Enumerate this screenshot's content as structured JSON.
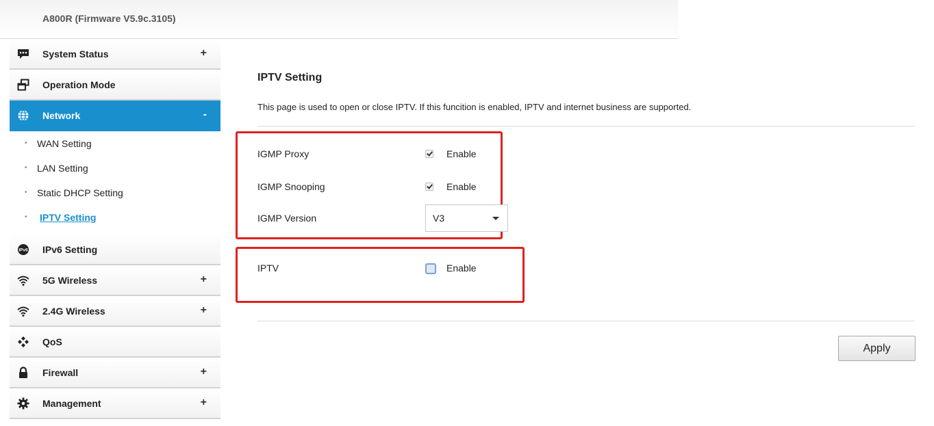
{
  "header": {
    "firmware_title": "A800R (Firmware V5.9c.3105)"
  },
  "sidebar": {
    "items": [
      {
        "label": "System Status",
        "icon": "chat-icon",
        "toggle": "+"
      },
      {
        "label": "Operation Mode",
        "icon": "windows-icon",
        "toggle": ""
      },
      {
        "label": "Network",
        "icon": "globe-icon",
        "toggle": "-"
      },
      {
        "label": "IPv6 Setting",
        "icon": "ipv6-icon",
        "toggle": ""
      },
      {
        "label": "5G Wireless",
        "icon": "wifi-icon",
        "toggle": "+"
      },
      {
        "label": "2.4G Wireless",
        "icon": "wifi-icon",
        "toggle": "+"
      },
      {
        "label": "QoS",
        "icon": "qos-icon",
        "toggle": ""
      },
      {
        "label": "Firewall",
        "icon": "lock-icon",
        "toggle": "+"
      },
      {
        "label": "Management",
        "icon": "gear-icon",
        "toggle": "+"
      }
    ],
    "network_sub": [
      {
        "label": "WAN Setting",
        "bullet": "•"
      },
      {
        "label": "LAN Setting",
        "bullet": "•"
      },
      {
        "label": "Static DHCP Setting",
        "bullet": "•"
      },
      {
        "label": "IPTV Setting",
        "bullet": "•"
      }
    ]
  },
  "main": {
    "title": "IPTV Setting",
    "description": "This page is used to open or close IPTV. If this funcition is enabled, IPTV and internet business are supported.",
    "igmp_proxy": {
      "label": "IGMP Proxy",
      "checked": true,
      "enable_label": "Enable"
    },
    "igmp_snooping": {
      "label": "IGMP Snooping",
      "checked": true,
      "enable_label": "Enable"
    },
    "igmp_version": {
      "label": "IGMP Version",
      "value": "V3"
    },
    "iptv": {
      "label": "IPTV",
      "checked": false,
      "enable_label": "Enable"
    },
    "apply_label": "Apply"
  },
  "colors": {
    "accent": "#1a8fce",
    "highlight_box": "#e02020"
  }
}
